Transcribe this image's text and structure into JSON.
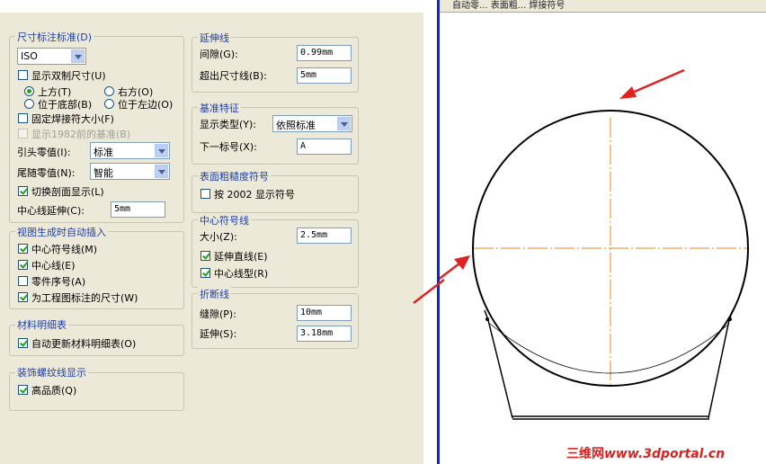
{
  "top_tabs": "自动零...  表面粗...  焊接符号",
  "dimension_standard": {
    "title": "尺寸标注标准(D)",
    "standard_value": "ISO",
    "dual_dimension_label": "显示双制尺寸(U)",
    "dual_dimension_checked": false,
    "top_label": "上方(T)",
    "top_checked": true,
    "right_label": "右方(O)",
    "right_checked": false,
    "bottom_label": "位于底部(B)",
    "bottom_checked": false,
    "left_label": "位于左边(O)",
    "left_checked": false,
    "fixed_weld_size_label": "固定焊接符大小(F)",
    "fixed_weld_size_checked": false,
    "show_1982_label": "显示1982前的基准(B)",
    "show_1982_checked": false,
    "leading_zero_label": "引头零值(I):",
    "leading_zero_value": "标准",
    "trailing_zero_label": "尾随零值(N):",
    "trailing_zero_value": "智能",
    "toggle_section_label": "切换剖面显示(L)",
    "toggle_section_checked": true,
    "centerline_ext_label": "中心线延伸(C):",
    "centerline_ext_value": "5mm"
  },
  "auto_insert": {
    "title": "视图生成时自动插入",
    "items": [
      {
        "label": "中心符号线(M)",
        "checked": true
      },
      {
        "label": "中心线(E)",
        "checked": true
      },
      {
        "label": "零件序号(A)",
        "checked": false
      },
      {
        "label": "为工程图标注的尺寸(W)",
        "checked": true
      }
    ]
  },
  "bom": {
    "title": "材料明细表",
    "auto_update_label": "自动更新材料明细表(O)",
    "auto_update_checked": true
  },
  "cosmetic_thread": {
    "title": "装饰螺纹线显示",
    "high_quality_label": "高品质(Q)",
    "high_quality_checked": true
  },
  "extension_lines": {
    "title": "延伸线",
    "gap_label": "间隙(G):",
    "gap_value": "0.99mm",
    "beyond_label": "超出尺寸线(B):",
    "beyond_value": "5mm"
  },
  "datum_feature": {
    "title": "基准特征",
    "display_type_label": "显示类型(Y):",
    "display_type_value": "依照标准",
    "next_label_label": "下一标号(X):",
    "next_label_value": "A"
  },
  "surface_finish": {
    "title": "表面粗糙度符号",
    "per_2002_label": "按 2002 显示符号",
    "per_2002_checked": false
  },
  "center_marks": {
    "title": "中心符号线",
    "size_label": "大小(Z):",
    "size_value": "2.5mm",
    "extended_lines_label": "延伸直线(E)",
    "extended_lines_checked": true,
    "centerline_font_label": "中心线型(R)",
    "centerline_font_checked": true
  },
  "break_line": {
    "title": "折断线",
    "gap_label": "缝隙(P):",
    "gap_value": "10mm",
    "extension_label": "延伸(S):",
    "extension_value": "3.18mm"
  },
  "watermark": {
    "cn": "三维网",
    "domain": "www.3dportal.cn"
  },
  "colors": {
    "group_title": "#1f3fa8",
    "centerline": "#e8891f",
    "arrow": "#e02222",
    "separator": "#1d2a9e"
  }
}
